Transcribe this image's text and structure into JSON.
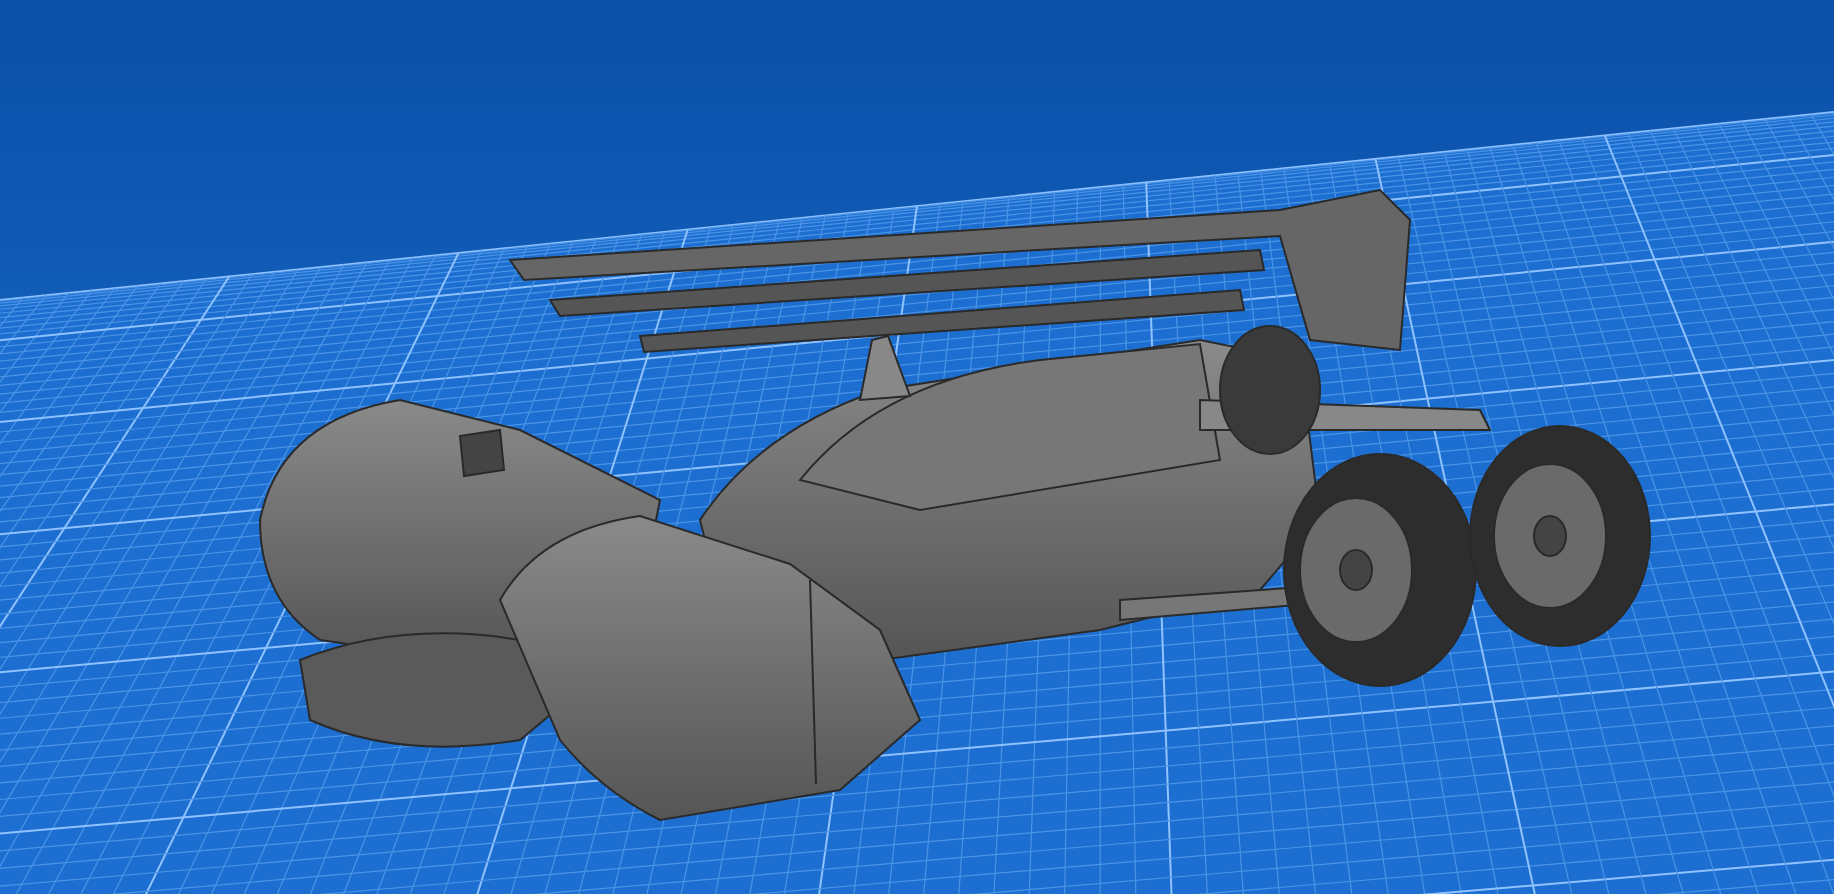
{
  "viewport": {
    "kind": "cad-render",
    "grid_visible": true
  }
}
